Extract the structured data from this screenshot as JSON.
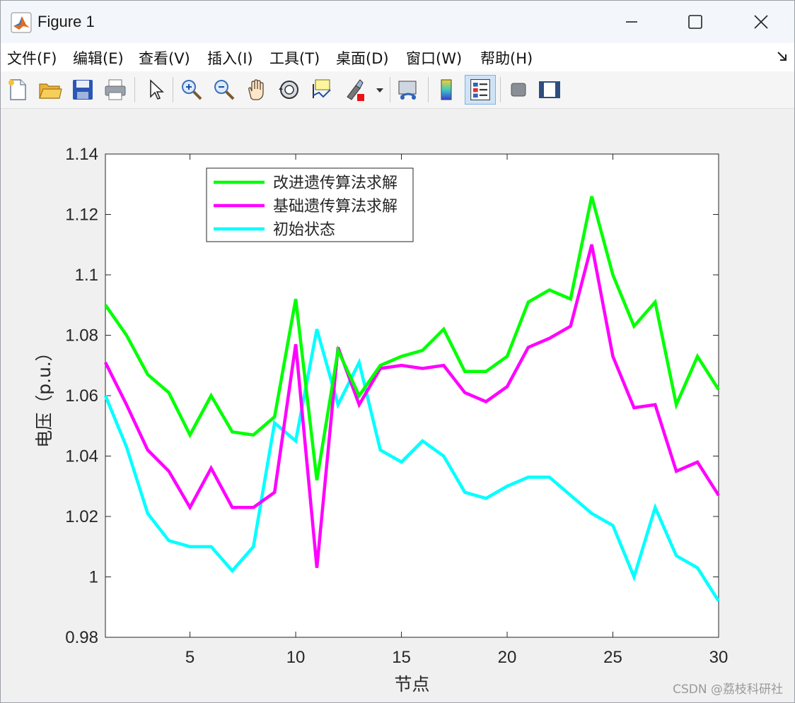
{
  "window": {
    "title": "Figure 1",
    "minimize_icon": "minimize-icon",
    "maximize_icon": "maximize-icon",
    "close_icon": "close-icon"
  },
  "menubar": {
    "items": [
      "文件(F)",
      "编辑(E)",
      "查看(V)",
      "插入(I)",
      "工具(T)",
      "桌面(D)",
      "窗口(W)",
      "帮助(H)"
    ],
    "dock_icon": "dock-arrow-icon"
  },
  "toolbar": {
    "icons": [
      "new-figure-icon",
      "open-file-icon",
      "save-icon",
      "print-icon",
      "pointer-icon",
      "zoom-in-icon",
      "zoom-out-icon",
      "pan-hand-icon",
      "rotate-3d-icon",
      "data-cursor-icon",
      "brush-icon",
      "brush-dropdown-icon",
      "link-plot-icon",
      "colorbar-icon",
      "legend-icon",
      "hide-plot-tools-icon",
      "show-plot-tools-icon"
    ]
  },
  "colors": {
    "green": "#00ff00",
    "magenta": "#ff00ff",
    "cyan": "#00ffff"
  },
  "chart_data": {
    "type": "line",
    "title": "",
    "xlabel": "节点",
    "ylabel": "电压（p.u.）",
    "xlim": [
      1,
      30
    ],
    "ylim": [
      0.98,
      1.14
    ],
    "xticks": [
      5,
      10,
      15,
      20,
      25,
      30
    ],
    "yticks": [
      0.98,
      1.0,
      1.02,
      1.04,
      1.06,
      1.08,
      1.1,
      1.12,
      1.14
    ],
    "ytick_labels": [
      "0.98",
      "1",
      "1.02",
      "1.04",
      "1.06",
      "1.08",
      "1.1",
      "1.12",
      "1.14"
    ],
    "grid": false,
    "legend_position": "top-left",
    "x": [
      1,
      2,
      3,
      4,
      5,
      6,
      7,
      8,
      9,
      10,
      11,
      12,
      13,
      14,
      15,
      16,
      17,
      18,
      19,
      20,
      21,
      22,
      23,
      24,
      25,
      26,
      27,
      28,
      29,
      30
    ],
    "series": [
      {
        "name": "改进遗传算法求解",
        "color": "#00ff00",
        "values": [
          1.09,
          1.08,
          1.067,
          1.061,
          1.047,
          1.06,
          1.048,
          1.047,
          1.053,
          1.092,
          1.032,
          1.075,
          1.06,
          1.07,
          1.073,
          1.075,
          1.082,
          1.068,
          1.068,
          1.073,
          1.091,
          1.095,
          1.092,
          1.126,
          1.1,
          1.083,
          1.091,
          1.057,
          1.073,
          1.062
        ]
      },
      {
        "name": "基础遗传算法求解",
        "color": "#ff00ff",
        "values": [
          1.071,
          1.057,
          1.042,
          1.035,
          1.023,
          1.036,
          1.023,
          1.023,
          1.028,
          1.077,
          1.003,
          1.076,
          1.057,
          1.069,
          1.07,
          1.069,
          1.07,
          1.061,
          1.058,
          1.063,
          1.076,
          1.079,
          1.083,
          1.11,
          1.073,
          1.056,
          1.057,
          1.035,
          1.038,
          1.027
        ]
      },
      {
        "name": "初始状态",
        "color": "#00ffff",
        "values": [
          1.06,
          1.043,
          1.021,
          1.012,
          1.01,
          1.01,
          1.002,
          1.01,
          1.051,
          1.045,
          1.082,
          1.057,
          1.071,
          1.042,
          1.038,
          1.045,
          1.04,
          1.028,
          1.026,
          1.03,
          1.033,
          1.033,
          1.027,
          1.021,
          1.017,
          1.0,
          1.023,
          1.007,
          1.003,
          0.992
        ]
      }
    ]
  },
  "watermark": "CSDN @荔枝科研社"
}
